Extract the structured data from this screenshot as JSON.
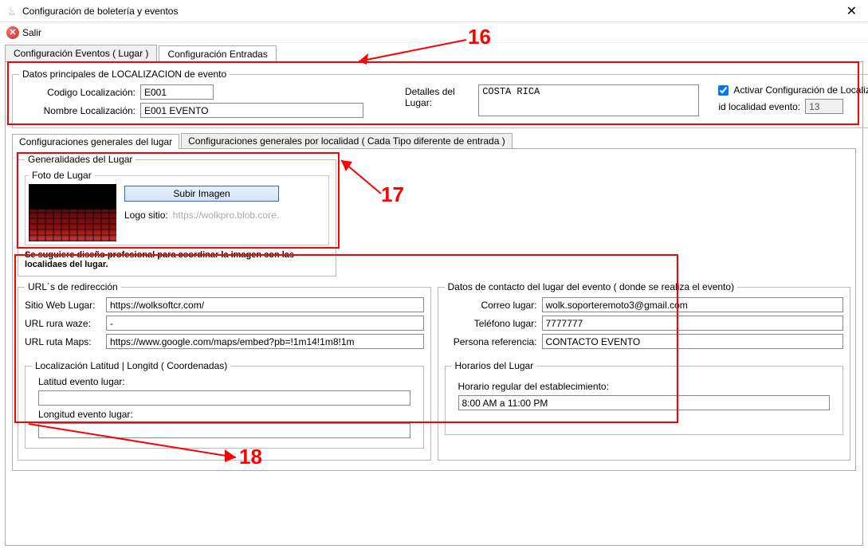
{
  "window": {
    "title": "Configuración de boletería y eventos",
    "exit_label": "Salir"
  },
  "main_tabs": {
    "tab1": "Configuración Eventos ( Lugar )",
    "tab2": "Configuración Entradas"
  },
  "loc_fieldset": {
    "legend": "Datos principales de LOCALIZACION de evento",
    "codigo_label": "Codigo Localización:",
    "codigo_value": "E001",
    "nombre_label": "Nombre Localización:",
    "nombre_value": "E001 EVENTO",
    "detalles_label": "Detalles del Lugar:",
    "detalles_value": "COSTA RICA",
    "activar_label": "Activar Configuración de Localización",
    "idloc_label": "id localidad evento:",
    "idloc_value": "13"
  },
  "inner_tabs": {
    "tab1": "Configuraciones generales del lugar",
    "tab2": "Configuraciones generales por localidad ( Cada Tipo diferente de entrada )"
  },
  "generalidades": {
    "legend": "Generalidades del Lugar",
    "foto_legend": "Foto de Lugar",
    "subir_btn": "Subir Imagen",
    "logo_label": "Logo sitio:",
    "logo_placeholder": "https://wolkpro.blob.core.",
    "note": "Se suguiere diseño profesional para coordinar la imagen con las localidaes del lugar."
  },
  "urls": {
    "legend": "URL´s de redirección",
    "sitio_label": "Sitio Web Lugar:",
    "sitio_value": "https://wolksoftcr.com/",
    "waze_label": "URL rura waze:",
    "waze_value": "-",
    "maps_label": "URL ruta Maps:",
    "maps_value": "https://www.google.com/maps/embed?pb=!1m14!1m8!1m",
    "coords_legend": "Localización Latitud | Longitd ( Coordenadas)",
    "lat_label": "Latitud evento lugar:",
    "lat_value": "",
    "lng_label": "Longitud evento lugar:",
    "lng_value": ""
  },
  "contacto": {
    "legend": "Datos de contacto del lugar del evento ( donde se realiza el evento)",
    "correo_label": "Correo lugar:",
    "correo_value": "wolk.soporteremoto3@gmail.com",
    "tel_label": "Teléfono lugar:",
    "tel_value": "7777777",
    "persona_label": "Persona referencia:",
    "persona_value": "CONTACTO EVENTO",
    "horarios_legend": "Horarios del Lugar",
    "horario_label": "Horario regular del establecimiento:",
    "horario_value": "8:00 AM a 11:00 PM"
  },
  "annotations": {
    "n16": "16",
    "n17": "17",
    "n18": "18"
  }
}
